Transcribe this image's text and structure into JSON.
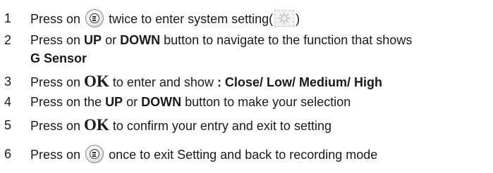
{
  "steps": [
    {
      "num": "1",
      "text_before": "Press on",
      "icon": "menu-button-icon",
      "text_after": "twice to enter system setting(",
      "icon2": "settings-gear-icon",
      "text_end": ")"
    },
    {
      "num": "2",
      "t1": "Press on ",
      "up": "UP",
      "or": " or ",
      "down": "DOWN",
      "t2": " button to navigate to the function that shows",
      "line2": "G Sensor"
    },
    {
      "num": "3",
      "t1": "Press on ",
      "ok": "OK",
      "t2": " to enter and show ",
      "options": ": Close/ Low/ Medium/ High"
    },
    {
      "num": "4",
      "t1": "Press on the ",
      "up": "UP",
      "or": " or ",
      "down": "DOWN",
      "t2": " button to make your selection"
    },
    {
      "num": "5",
      "t1": "Press on ",
      "ok": "OK",
      "t2": " to confirm your entry and exit to setting"
    },
    {
      "num": "6",
      "text_before": "Press on",
      "icon": "menu-button-icon",
      "text_after": "once to exit Setting and back to recording mode"
    }
  ],
  "colors": {
    "text": "#1a1a1a",
    "background": "#ffffff"
  }
}
